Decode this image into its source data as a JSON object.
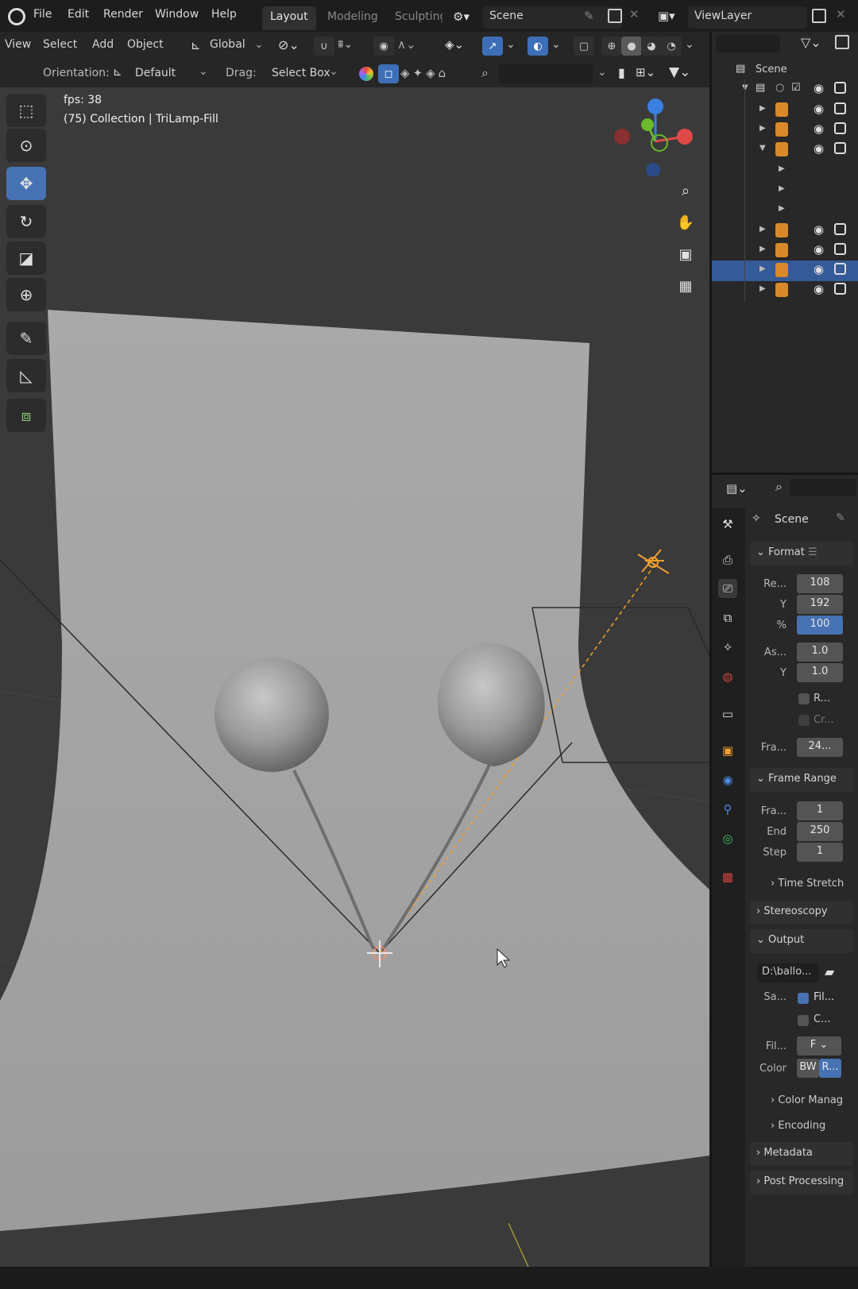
{
  "topbar": {
    "menus": [
      "File",
      "Edit",
      "Render",
      "Window",
      "Help"
    ],
    "workspaces": [
      "Layout",
      "Modeling",
      "Sculpting"
    ],
    "active_workspace": "Layout",
    "scene": "Scene",
    "view_layer": "ViewLayer"
  },
  "viewport_header": {
    "menus": [
      "View",
      "Select",
      "Add",
      "Object"
    ],
    "transform_orientation": "Global",
    "orientation_label": "Orientation:",
    "orientation_value": "Default",
    "drag_label": "Drag:",
    "drag_value": "Select Box"
  },
  "viewport": {
    "fps": "fps: 38",
    "object_info": "(75) Collection | TriLamp-Fill"
  },
  "outliner": {
    "root": "Scene"
  },
  "properties": {
    "context": "Scene",
    "format_panel": "Format",
    "res_x_label": "Re...",
    "res_x": "108",
    "res_y_label": "Y",
    "res_y": "192",
    "pct_label": "%",
    "pct": "100",
    "aspect_x_label": "As...",
    "aspect_x": "1.0",
    "aspect_y_label": "Y",
    "aspect_y": "1.0",
    "render_region": "R...",
    "crop": "Cr...",
    "frame_rate_label": "Fra...",
    "frame_rate": "24...",
    "frame_range_panel": "Frame Range",
    "frame_start_label": "Fra...",
    "frame_start": "1",
    "frame_end_label": "End",
    "frame_end": "250",
    "step_label": "Step",
    "step": "1",
    "time_stretch": "Time Stretch",
    "stereoscopy": "Stereoscopy",
    "output_panel": "Output",
    "output_path": "D:\\ballo...",
    "save_label": "Sa...",
    "file_ext": "Fil...",
    "cache": "C...",
    "file_format_label": "Fil...",
    "file_format": "F",
    "color_label": "Color",
    "color_bw": "BW",
    "color_rgb": "R...",
    "color_management": "Color Manag",
    "encoding": "Encoding",
    "metadata": "Metadata",
    "post_processing": "Post Processing"
  },
  "colors": {
    "accent": "#4772b3",
    "selection": "#345a98",
    "light_orange": "#f0a030"
  }
}
